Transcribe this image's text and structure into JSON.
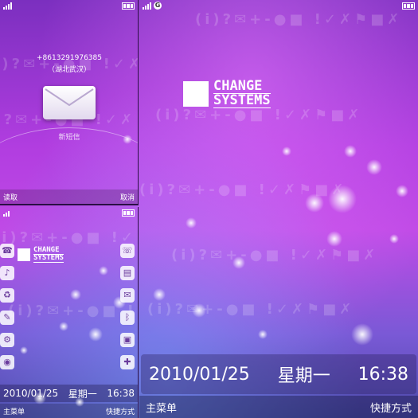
{
  "screens": {
    "message": {
      "phone_number": "+8613291976385",
      "location": "（湖北武汉）",
      "hint": "新短信",
      "left_soft": "读取",
      "right_soft": "取消"
    },
    "home_small": {
      "date": "2010/01/25",
      "weekday": "星期一",
      "time": "16:38",
      "left_soft": "主菜单",
      "right_soft": "快捷方式"
    },
    "home_big": {
      "network": "G",
      "date": "2010/01/25",
      "weekday": "星期一",
      "time": "16:38",
      "left_soft": "主菜单",
      "right_soft": "快捷方式"
    }
  },
  "logo": {
    "line1": "CHANGE",
    "line2": "SYSTEMS"
  },
  "watermark": "(i)?✉+-●■ !✓✗⚑■✗",
  "icons": {
    "left": [
      "contact-icon",
      "music-icon",
      "recycle-icon",
      "tools-icon",
      "settings-icon",
      "camera-icon"
    ],
    "right": [
      "phone-icon",
      "folder-icon",
      "message-icon",
      "bluetooth-icon",
      "car-icon",
      "game-icon"
    ],
    "left_glyphs": [
      "☎",
      "♪",
      "♻",
      "✎",
      "⚙",
      "◉"
    ],
    "right_glyphs": [
      "☏",
      "▤",
      "✉",
      "ᛒ",
      "▣",
      "✚"
    ]
  },
  "colors": {
    "accent": "#b13de0",
    "dark": "#2a0f44"
  }
}
